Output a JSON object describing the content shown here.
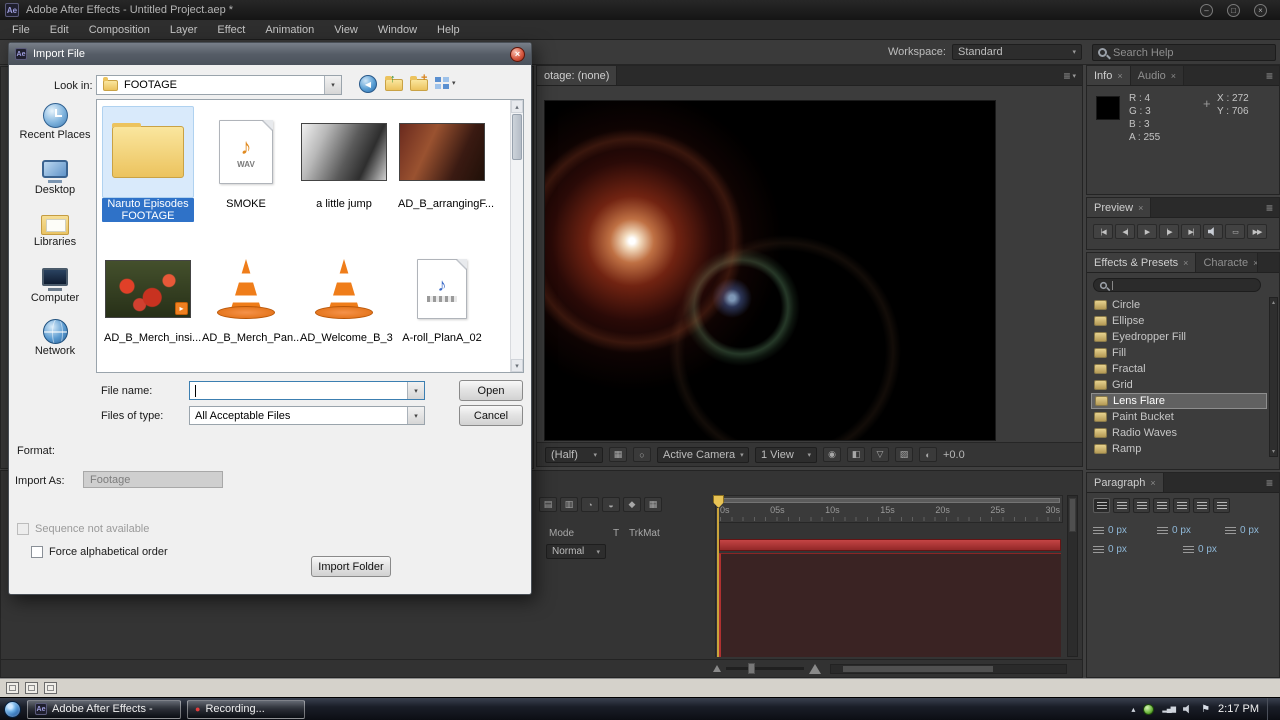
{
  "icons": {
    "app_logo": "Ae",
    "dropdown_arrow": "▾",
    "panel_menu": "≡",
    "tab_close": "×",
    "scroll_up": "▴",
    "scroll_down": "▾",
    "back_arrow": "◀",
    "up_arrow": "↑",
    "new_folder_plus": "+",
    "note": "♪",
    "wav_label": "WAV",
    "crosshair": "+",
    "minimize": "–",
    "maximize": "□",
    "close": "×",
    "tray_arrow": "▴",
    "net_bars": "▂▄▆",
    "flag": "⚑",
    "play_badge": "▸",
    "record_dot": "●"
  },
  "titlebar": {
    "title": "Adobe After Effects - Untitled Project.aep *"
  },
  "menubar": {
    "items": [
      "File",
      "Edit",
      "Composition",
      "Layer",
      "Effect",
      "Animation",
      "View",
      "Window",
      "Help"
    ]
  },
  "toolbar": {
    "workspace_label": "Workspace:",
    "workspace_value": "Standard",
    "search_placeholder": "Search Help"
  },
  "import_dialog": {
    "title": "Import File",
    "look_in_label": "Look in:",
    "look_in_value": "FOOTAGE",
    "places": [
      {
        "label": "Recent Places"
      },
      {
        "label": "Desktop"
      },
      {
        "label": "Libraries"
      },
      {
        "label": "Computer"
      },
      {
        "label": "Network"
      }
    ],
    "files": [
      {
        "label": "Naruto Episodes FOOTAGE",
        "kind": "folder",
        "selected": true
      },
      {
        "label": "SMOKE",
        "kind": "wav-audio",
        "selected": false
      },
      {
        "label": "a little jump",
        "kind": "video-thumbnail",
        "selected": false
      },
      {
        "label": "AD_B_arrangingF...",
        "kind": "video-thumbnail",
        "selected": false
      },
      {
        "label": "AD_B_Merch_insi...",
        "kind": "video-thumbnail",
        "selected": false
      },
      {
        "label": "AD_B_Merch_Pan...",
        "kind": "vlc-video",
        "selected": false
      },
      {
        "label": "AD_Welcome_B_3",
        "kind": "vlc-video",
        "selected": false
      },
      {
        "label": "A-roll_PlanA_02",
        "kind": "media-document",
        "selected": false
      }
    ],
    "file_name_label": "File name:",
    "file_name_value": "",
    "files_of_type_label": "Files of type:",
    "files_of_type_value": "All Acceptable Files",
    "open_button": "Open",
    "cancel_button": "Cancel",
    "format_label": "Format:",
    "import_as_label": "Import As:",
    "import_as_value": "Footage",
    "sequence_checkbox": "Sequence not available",
    "alphabetical_checkbox": "Force alphabetical order",
    "import_folder_button": "Import Folder"
  },
  "comp_panel": {
    "tab": "otage: (none)",
    "magnification": "(Half)",
    "camera": "Active Camera",
    "view_layout": "1 View",
    "exposure": "+0.0",
    "icons": [
      {
        "name": "grid-options-icon",
        "glyph": "▦"
      },
      {
        "name": "mask-visibility-icon",
        "glyph": "○"
      },
      {
        "name": "snapshot-icon",
        "glyph": "◉"
      },
      {
        "name": "show-channels-icon",
        "glyph": "◧"
      },
      {
        "name": "resolution-icon",
        "glyph": "▽"
      },
      {
        "name": "transparency-grid-icon",
        "glyph": "▨"
      },
      {
        "name": "exposure-icon",
        "glyph": "◐"
      }
    ]
  },
  "timeline": {
    "mode_header": "Mode",
    "t_header": "T",
    "trkmat_header": "TrkMat",
    "blend_mode": "Normal",
    "ruler_labels": [
      "0s",
      "05s",
      "10s",
      "15s",
      "20s",
      "25s",
      "30s"
    ],
    "tool_icons": [
      {
        "name": "comp-flowchart-icon",
        "glyph": "▤"
      },
      {
        "name": "draft-3d-icon",
        "glyph": "▥"
      },
      {
        "name": "hide-shy-icon",
        "glyph": "◔"
      },
      {
        "name": "frame-blend-icon",
        "glyph": "◒"
      },
      {
        "name": "motion-blur-icon",
        "glyph": "◆"
      },
      {
        "name": "graph-editor-icon",
        "glyph": "▦"
      }
    ]
  },
  "info_panel": {
    "tab": "Info",
    "tab2": "Audio",
    "r": "R : 4",
    "g": "G : 3",
    "b": "B : 3",
    "a": "A : 255",
    "x": "X : 272",
    "y": "Y : 706"
  },
  "preview_panel": {
    "tab": "Preview",
    "buttons": [
      {
        "name": "first-frame",
        "glyph": "|◀"
      },
      {
        "name": "previous-frame",
        "glyph": "◀|"
      },
      {
        "name": "play",
        "glyph": "▶"
      },
      {
        "name": "next-frame",
        "glyph": "|▶"
      },
      {
        "name": "last-frame",
        "glyph": "▶|"
      },
      {
        "name": "audio-toggle",
        "glyph": ""
      },
      {
        "name": "loop",
        "glyph": "▭"
      },
      {
        "name": "ram-preview",
        "glyph": "▶▶"
      }
    ]
  },
  "effects_panel": {
    "tab": "Effects & Presets",
    "tab2": "Characte",
    "items": [
      "Circle",
      "Ellipse",
      "Eyedropper Fill",
      "Fill",
      "Fractal",
      "Grid",
      "Lens Flare",
      "Paint Bucket",
      "Radio Waves",
      "Ramp"
    ],
    "selected_item": "Lens Flare"
  },
  "paragraph_panel": {
    "tab": "Paragraph",
    "row1": [
      "0 px",
      "0 px",
      "0 px"
    ],
    "row2": [
      "0 px",
      "0 px"
    ]
  },
  "taskbar": {
    "task1": "Adobe After Effects -",
    "task2": "Recording...",
    "clock": "2:17 PM"
  }
}
